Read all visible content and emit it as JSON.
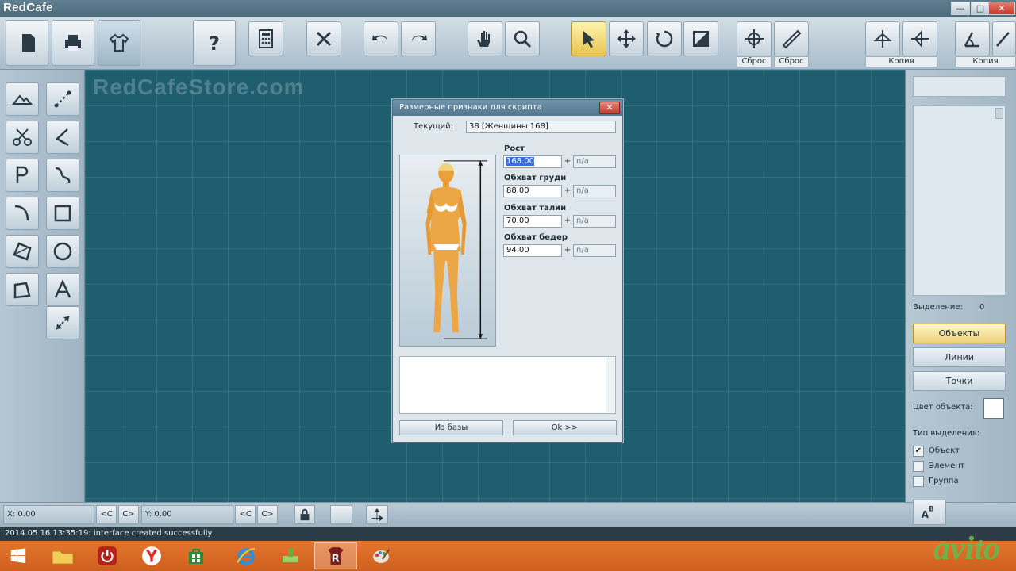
{
  "app": {
    "title": "RedCafe",
    "watermark": "RedCafeStore.com"
  },
  "window_controls": {
    "minimize": "—",
    "maximize": "□",
    "close": "✕"
  },
  "toolbar": {
    "labels": {
      "reset1": "Сброс",
      "reset2": "Сброс",
      "copy1": "Копия",
      "copy2": "Копия"
    }
  },
  "dialog": {
    "title": "Размерные признаки для скрипта",
    "close": "✕",
    "current_label": "Текущий:",
    "current_value": "38   [Женщины 168]",
    "fields": [
      {
        "label": "Рост",
        "value": "168.00",
        "plus": "+",
        "na": "n/a"
      },
      {
        "label": "Обхват груди",
        "value": "88.00",
        "plus": "+",
        "na": "n/a"
      },
      {
        "label": "Обхват талии",
        "value": "70.00",
        "plus": "+",
        "na": "n/a"
      },
      {
        "label": "Обхват бедер",
        "value": "94.00",
        "plus": "+",
        "na": "n/a"
      }
    ],
    "btn_db": "Из базы",
    "btn_ok": "Ok >>"
  },
  "right_panel": {
    "selection_label": "Выделение:",
    "selection_count": "0",
    "btn_objects": "Объекты",
    "btn_lines": "Линии",
    "btn_points": "Точки",
    "color_label": "Цвет объекта:",
    "sel_type_label": "Тип выделения:",
    "opt_object": "Объект",
    "opt_element": "Элемент",
    "opt_group": "Группа"
  },
  "bottom": {
    "x_label": "X:",
    "x_value": "0.00",
    "y_label": "Y:",
    "y_value": "0.00",
    "lt": "<C",
    "gt": "C>"
  },
  "status": {
    "text": "2014.05.16 13:35:19: interface created successfully"
  },
  "overlay": {
    "avito": "avito"
  },
  "colors": {
    "canvas": "#1f5e6e",
    "taskbar": "#d9692a",
    "active_tool": "#e7c44c"
  }
}
